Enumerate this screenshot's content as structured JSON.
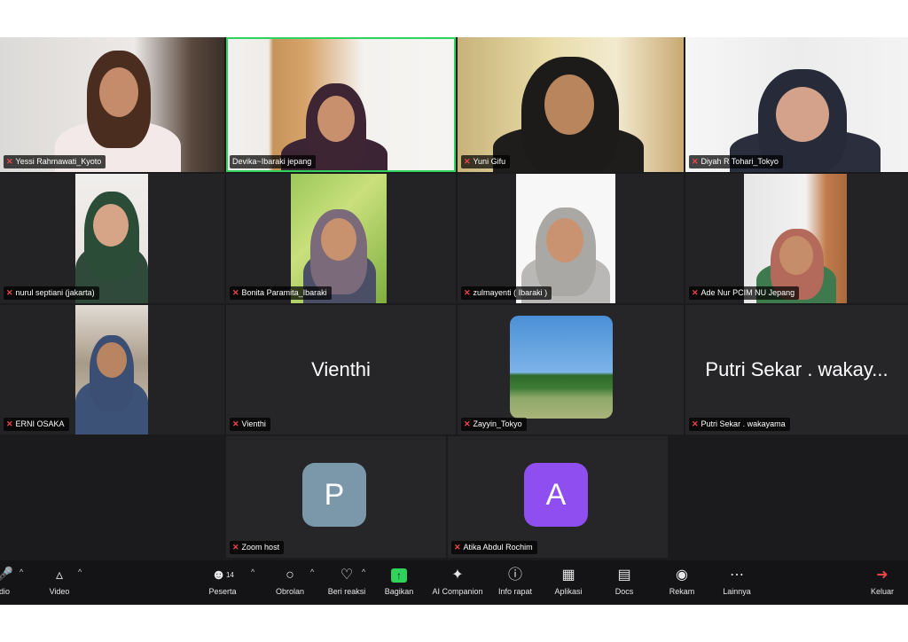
{
  "participants": {
    "yessi": "Yessi Rahmawati_Kyoto",
    "devika": "Devika~Ibaraki jepang",
    "yuni": "Yuni Gifu",
    "diyah": "Diyah R Tohari_Tokyo",
    "nurul": "nurul septiani (jakarta)",
    "bonita": "Bonita Paramita_Ibaraki",
    "zulmayenti": "zulmayenti ( Ibaraki )",
    "ade": "Ade Nur PCIM NU Jepang",
    "erni": "ERNI OSAKA",
    "vienthi": "Vienthi",
    "zayyin": "Zayyin_Tokyo",
    "putri": "Putri Sekar . wakayama",
    "putri_short": "Putri Sekar . wakay...",
    "zoomhost": "Zoom host",
    "atika": "Atika Abdul Rochim"
  },
  "avatars": {
    "zoomhost_letter": "P",
    "zoomhost_color": "#7b98aa",
    "atika_letter": "A",
    "atika_color": "#8f4ff0"
  },
  "toolbar": {
    "audio": "dio",
    "video": "Video",
    "participants": "Peserta",
    "participants_count": "14",
    "chat": "Obrolan",
    "reactions": "Beri reaksi",
    "share": "Bagikan",
    "ai": "AI Companion",
    "info": "Info rapat",
    "apps": "Aplikasi",
    "docs": "Docs",
    "record": "Rekam",
    "more": "Lainnya",
    "leave": "Keluar"
  },
  "colors": {
    "active_speaker": "#2fd35b",
    "mic_muted": "#f0464a",
    "share": "#2fd35b"
  },
  "icons": [
    "mic-icon",
    "video-camera-icon",
    "participants-icon",
    "chat-icon",
    "heart-icon",
    "share-arrow-icon",
    "sparkle-icon",
    "info-icon",
    "apps-icon",
    "docs-icon",
    "record-icon",
    "more-icon",
    "leave-icon"
  ]
}
